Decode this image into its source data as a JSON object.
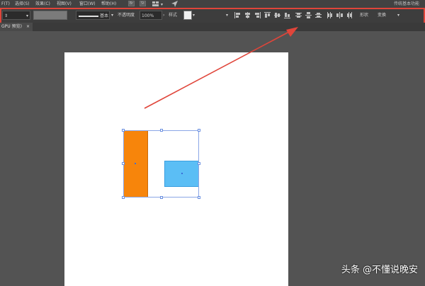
{
  "menubar": {
    "items": [
      {
        "label": "F(T)"
      },
      {
        "label": "选择(S)"
      },
      {
        "label": "效果(C)"
      },
      {
        "label": "视图(V)"
      },
      {
        "label": "窗口(W)"
      },
      {
        "label": "帮助(H)"
      }
    ],
    "br_label": "Br",
    "st_label": "St",
    "workspace": "传统基本功能"
  },
  "toolbar": {
    "stroke_profile": "基本",
    "opacity_label": "不透明度",
    "opacity_value": "100%",
    "style_label": "样式",
    "shape_label": "形状",
    "transform_label": "变换"
  },
  "tabs": [
    {
      "label": "GPU 预览)",
      "close": "×"
    }
  ],
  "colors": {
    "orange_rect": "#f7850b",
    "blue_rect": "#5bbef5",
    "highlight": "#e0453a"
  },
  "watermark": "头条 @不懂说晚安"
}
